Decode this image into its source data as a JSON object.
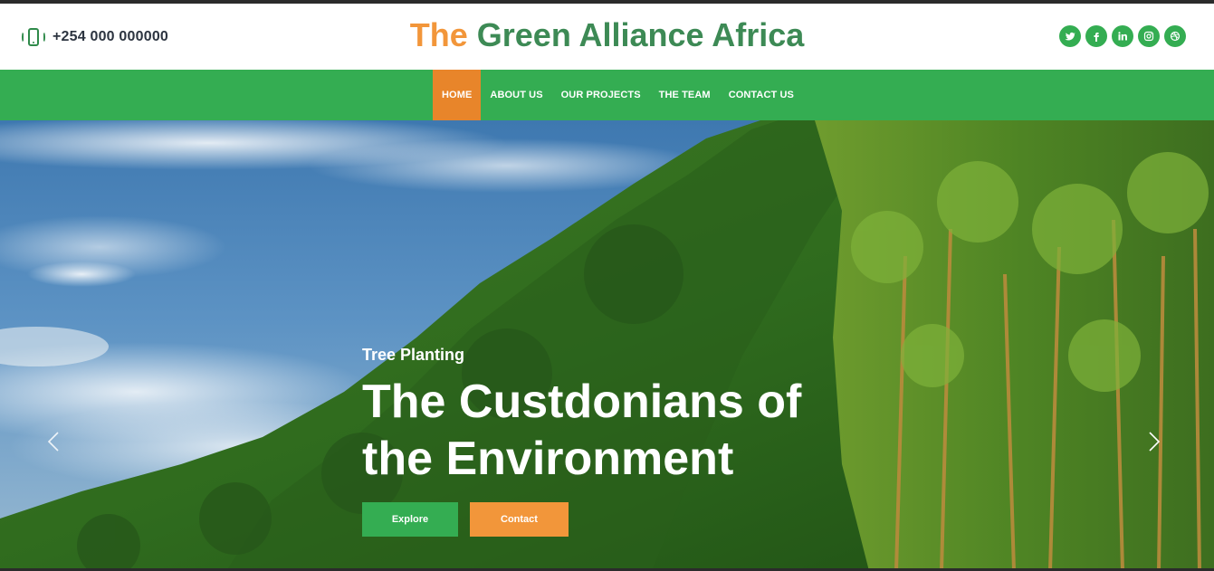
{
  "header": {
    "phone": {
      "icon": "phone-vibrate-icon",
      "number": "+254 000 000000"
    },
    "brand": {
      "prefix": "The",
      "name": "Green Alliance Africa"
    },
    "socials": [
      "twitter-icon",
      "facebook-icon",
      "linkedin-icon",
      "instagram-icon",
      "dribbble-icon"
    ]
  },
  "nav": {
    "items": [
      {
        "label": "HOME",
        "active": true
      },
      {
        "label": "ABOUT US"
      },
      {
        "label": "OUR PROJECTS"
      },
      {
        "label": "THE TEAM"
      },
      {
        "label": "CONTACT US"
      }
    ]
  },
  "hero": {
    "subtitle": "Tree Planting",
    "headline": "The Custdonians of the Environment",
    "buttons": {
      "explore": "Explore",
      "contact": "Contact"
    },
    "arrows": {
      "prev": "chevron-left-icon",
      "next": "chevron-right-icon"
    }
  },
  "colors": {
    "green": "#34ad52",
    "orange": "#e8852a",
    "brand_green": "#3d8a55",
    "brand_orange": "#f2963a"
  }
}
